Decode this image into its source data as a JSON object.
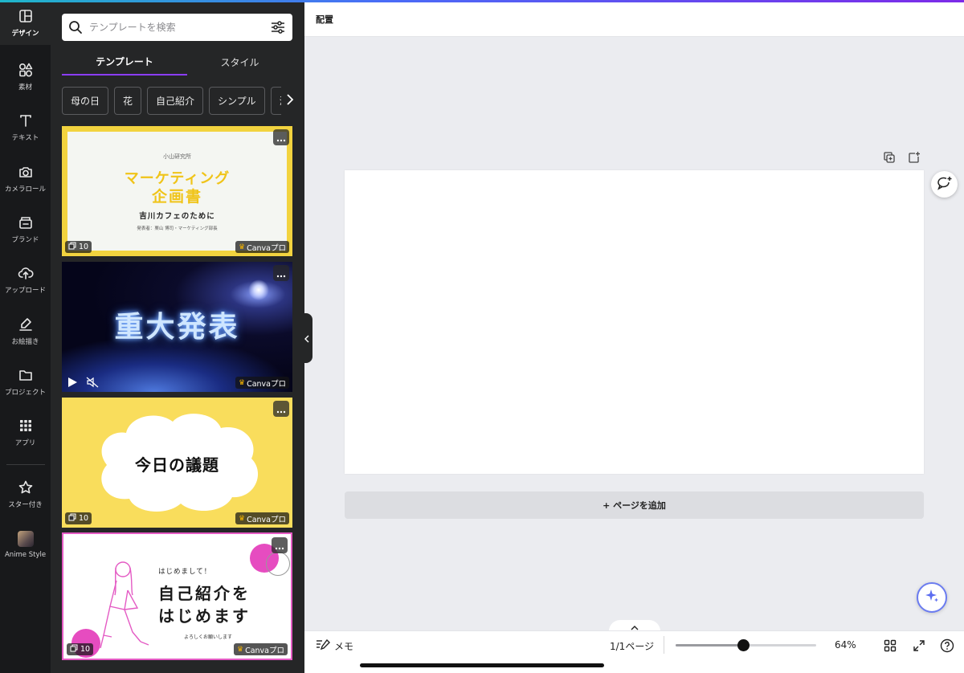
{
  "colors": {
    "rail_bg": "#18191b",
    "panel_bg": "#252627",
    "accent": "#8b3dff",
    "canvas_bg": "#ebecf0",
    "pro_crown": "#f5b400"
  },
  "rail": {
    "items": [
      {
        "label": "デザイン",
        "icon": "layout-icon"
      },
      {
        "label": "素材",
        "icon": "shapes-icon"
      },
      {
        "label": "テキスト",
        "icon": "text-icon"
      },
      {
        "label": "カメラロール",
        "icon": "camera-icon"
      },
      {
        "label": "ブランド",
        "icon": "brand-icon"
      },
      {
        "label": "アップロード",
        "icon": "cloud-upload-icon"
      },
      {
        "label": "お絵描き",
        "icon": "draw-icon"
      },
      {
        "label": "プロジェクト",
        "icon": "folder-icon"
      },
      {
        "label": "アプリ",
        "icon": "apps-grid-icon"
      },
      {
        "label": "スター付き",
        "icon": "star-icon"
      },
      {
        "label": "Anime Style",
        "icon": "avatar-image"
      }
    ]
  },
  "panel": {
    "search_placeholder": "テンプレートを検索",
    "tabs": [
      "テンプレート",
      "スタイル"
    ],
    "chips": [
      "母の日",
      "花",
      "自己紹介",
      "シンプル",
      "海"
    ],
    "cards": [
      {
        "org": "小山研究所",
        "title_line1": "マーケティング",
        "title_line2": "企画書",
        "subtitle": "吉川カフェのために",
        "footer": "発表者：栗山 博司・マーケティング部長",
        "pages": "10",
        "badge": "Canvaプロ"
      },
      {
        "title": "重大発表",
        "badge": "Canvaプロ"
      },
      {
        "title": "今日の議題",
        "pages": "10",
        "badge": "Canvaプロ"
      },
      {
        "hello": "はじめまして！",
        "line1": "自己紹介を",
        "line2": "はじめます",
        "footer": "よろしくお願いします",
        "pages": "10",
        "badge": "Canvaプロ"
      }
    ]
  },
  "topbar": {
    "arrange": "配置"
  },
  "canvas": {
    "add_page": "+ ページを追加"
  },
  "bottombar": {
    "memo": "メモ",
    "pages": "1/1ページ",
    "zoom": "64%",
    "zoom_fraction": 0.48
  }
}
